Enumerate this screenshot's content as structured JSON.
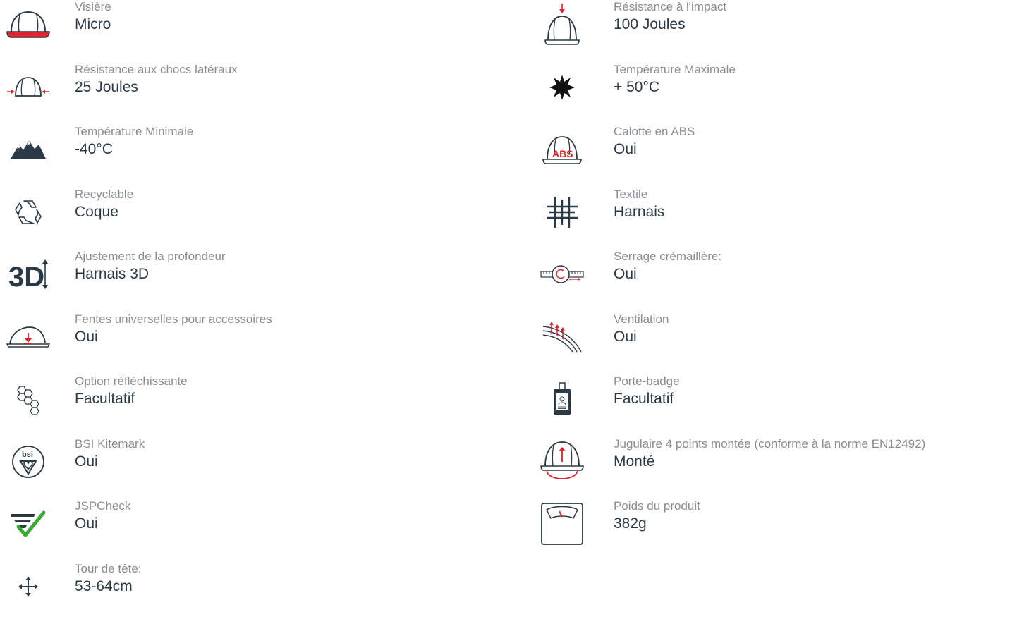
{
  "colors": {
    "label": "#8a8d91",
    "value": "#2b3a46",
    "icon": "#2b3a46",
    "accent": "#d9262c",
    "check": "#3aa935"
  },
  "left": [
    {
      "label": "Visière",
      "value": "Micro",
      "icon": "helmet-visor-icon"
    },
    {
      "label": "Résistance aux chocs latéraux",
      "value": "25 Joules",
      "icon": "lateral-impact-icon"
    },
    {
      "label": "Température Minimale",
      "value": "-40°C",
      "icon": "mountains-icon"
    },
    {
      "label": "Recyclable",
      "value": "Coque",
      "icon": "recycle-icon"
    },
    {
      "label": "Ajustement de la profondeur",
      "value": "Harnais 3D",
      "icon": "3d-depth-icon"
    },
    {
      "label": "Fentes universelles pour accessoires",
      "value": "Oui",
      "icon": "accessory-slot-icon"
    },
    {
      "label": "Option réfléchissante",
      "value": "Facultatif",
      "icon": "hexagon-reflective-icon"
    },
    {
      "label": "BSI Kitemark",
      "value": "Oui",
      "icon": "bsi-kitemark-icon",
      "icon_text": "bsi"
    },
    {
      "label": "JSPCheck",
      "value": "Oui",
      "icon": "jspcheck-icon"
    },
    {
      "label": "Tour de tête:",
      "value": "53-64cm",
      "icon": "move-arrows-icon"
    }
  ],
  "right": [
    {
      "label": "Résistance à l'impact",
      "value": "100 Joules",
      "icon": "top-impact-icon"
    },
    {
      "label": "Température Maximale",
      "value": "+ 50°C",
      "icon": "sun-icon"
    },
    {
      "label": "Calotte en ABS",
      "value": "Oui",
      "icon": "abs-shell-icon",
      "icon_text": "ABS"
    },
    {
      "label": "Textile",
      "value": "Harnais",
      "icon": "textile-icon"
    },
    {
      "label": "Serrage crémaillère:",
      "value": "Oui",
      "icon": "ratchet-icon"
    },
    {
      "label": "Ventilation",
      "value": "Oui",
      "icon": "ventilation-icon"
    },
    {
      "label": "Porte-badge",
      "value": "Facultatif",
      "icon": "badge-holder-icon"
    },
    {
      "label": "Jugulaire 4 points montée (conforme à la norme EN12492)",
      "value": "Monté",
      "icon": "chinstrap-icon"
    },
    {
      "label": "Poids du produit",
      "value": "382g",
      "icon": "scale-icon"
    }
  ]
}
